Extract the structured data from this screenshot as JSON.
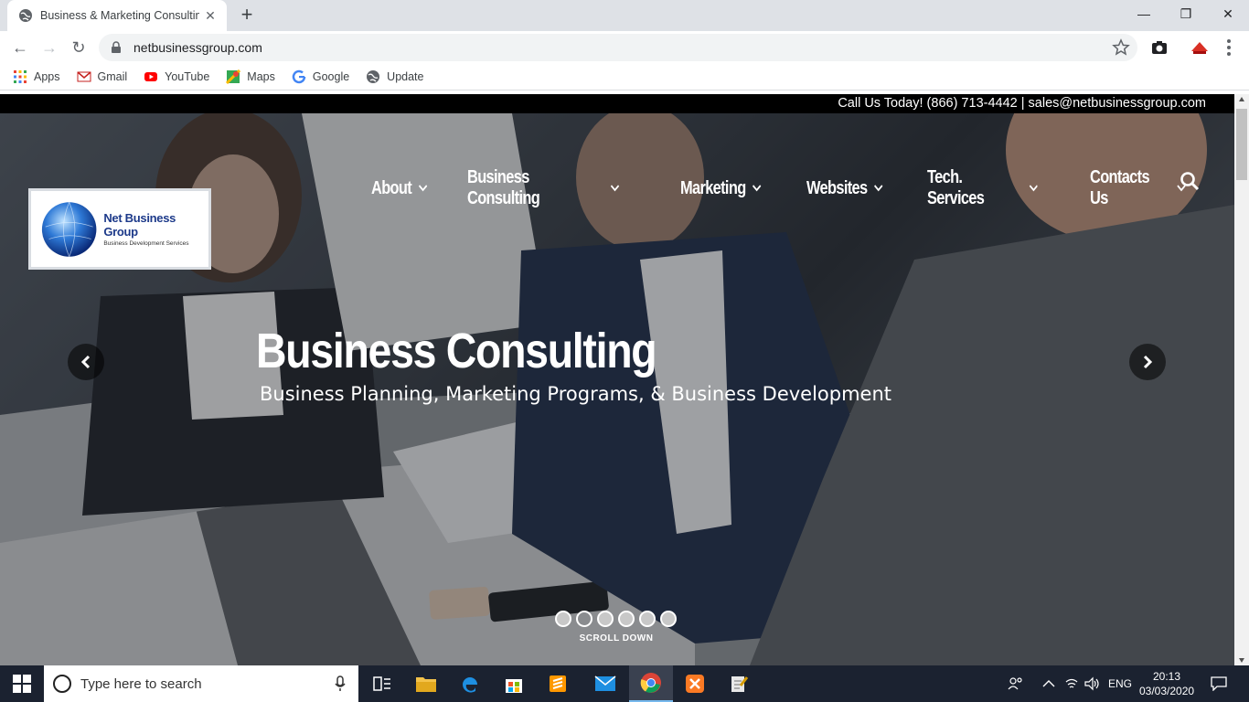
{
  "browser": {
    "tab_title": "Business & Marketing Consulting",
    "new_tab_symbol": "+",
    "url": "netbusinessgroup.com",
    "bookmarks": [
      {
        "label": "Apps",
        "icon": "apps-grid-icon"
      },
      {
        "label": "Gmail",
        "icon": "gmail-icon"
      },
      {
        "label": "YouTube",
        "icon": "youtube-icon"
      },
      {
        "label": "Maps",
        "icon": "maps-icon"
      },
      {
        "label": "Google",
        "icon": "google-icon"
      },
      {
        "label": "Update",
        "icon": "globe-icon"
      }
    ]
  },
  "site": {
    "topbar_text": "Call Us Today! (866) 713-4442 | sales@netbusinessgroup.com",
    "logo": {
      "name": "Net Business Group",
      "tagline": "Business Development Services"
    },
    "nav": [
      {
        "label": "About"
      },
      {
        "label": "Business Consulting"
      },
      {
        "label": "Marketing"
      },
      {
        "label": "Websites"
      },
      {
        "label": "Tech. Services"
      },
      {
        "label": "Contacts Us"
      }
    ],
    "slide": {
      "title": "Business Consulting",
      "subtitle": "Business Planning, Marketing Programs, & Business Development"
    },
    "slide_count": 6,
    "active_slide": 2,
    "scroll_label": "SCROLL DOWN"
  },
  "taskbar": {
    "search_placeholder": "Type here to search",
    "language": "ENG",
    "time": "20:13",
    "date": "03/03/2020"
  },
  "colors": {
    "accent": "#1d3a8a",
    "taskbar": "#1b2230",
    "topbar": "#000000"
  }
}
